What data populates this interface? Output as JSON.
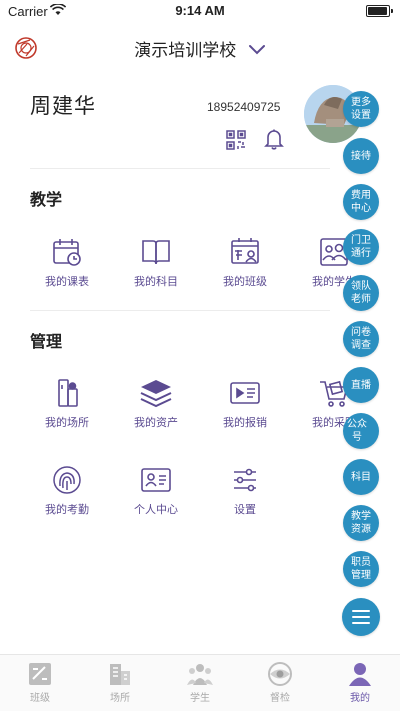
{
  "status_bar": {
    "carrier": "Carrier",
    "time": "9:14 AM"
  },
  "header": {
    "title": "演示培训学校"
  },
  "profile": {
    "name": "周建华",
    "phone": "18952409725"
  },
  "sections": {
    "teaching": {
      "title": "教学",
      "items": [
        {
          "label": "我的课表",
          "icon": "calendar-clock-icon"
        },
        {
          "label": "我的科目",
          "icon": "book-icon"
        },
        {
          "label": "我的班级",
          "icon": "class-board-icon"
        },
        {
          "label": "我的学生",
          "icon": "students-icon"
        }
      ]
    },
    "management": {
      "title": "管理",
      "items": [
        {
          "label": "我的场所",
          "icon": "venue-icon"
        },
        {
          "label": "我的资产",
          "icon": "layers-icon"
        },
        {
          "label": "我的报销",
          "icon": "ticket-icon"
        },
        {
          "label": "我的采购",
          "icon": "cart-icon"
        },
        {
          "label": "我的考勤",
          "icon": "fingerprint-icon"
        },
        {
          "label": "个人中心",
          "icon": "id-card-icon"
        },
        {
          "label": "设置",
          "icon": "sliders-icon"
        }
      ]
    }
  },
  "floating_menu": [
    {
      "l1": "更多",
      "l2": "设置"
    },
    {
      "l1": "接待",
      "l2": ""
    },
    {
      "l1": "费用",
      "l2": "中心"
    },
    {
      "l1": "门卫",
      "l2": "通行"
    },
    {
      "l1": "领队",
      "l2": "老师"
    },
    {
      "l1": "问卷",
      "l2": "调查"
    },
    {
      "l1": "直播",
      "l2": ""
    },
    {
      "l1": "公众号",
      "l2": ""
    },
    {
      "l1": "科目",
      "l2": ""
    },
    {
      "l1": "教学",
      "l2": "资源"
    },
    {
      "l1": "职员",
      "l2": "管理"
    }
  ],
  "tab_bar": [
    {
      "label": "班级",
      "icon": "class-tab-icon"
    },
    {
      "label": "场所",
      "icon": "building-tab-icon"
    },
    {
      "label": "学生",
      "icon": "students-tab-icon"
    },
    {
      "label": "督检",
      "icon": "eye-tab-icon"
    },
    {
      "label": "我的",
      "icon": "user-tab-icon",
      "active": true
    }
  ],
  "colors": {
    "accent": "#5b4b91",
    "fab": "#2a8fc0",
    "tab_inactive": "#aaaaaa"
  }
}
